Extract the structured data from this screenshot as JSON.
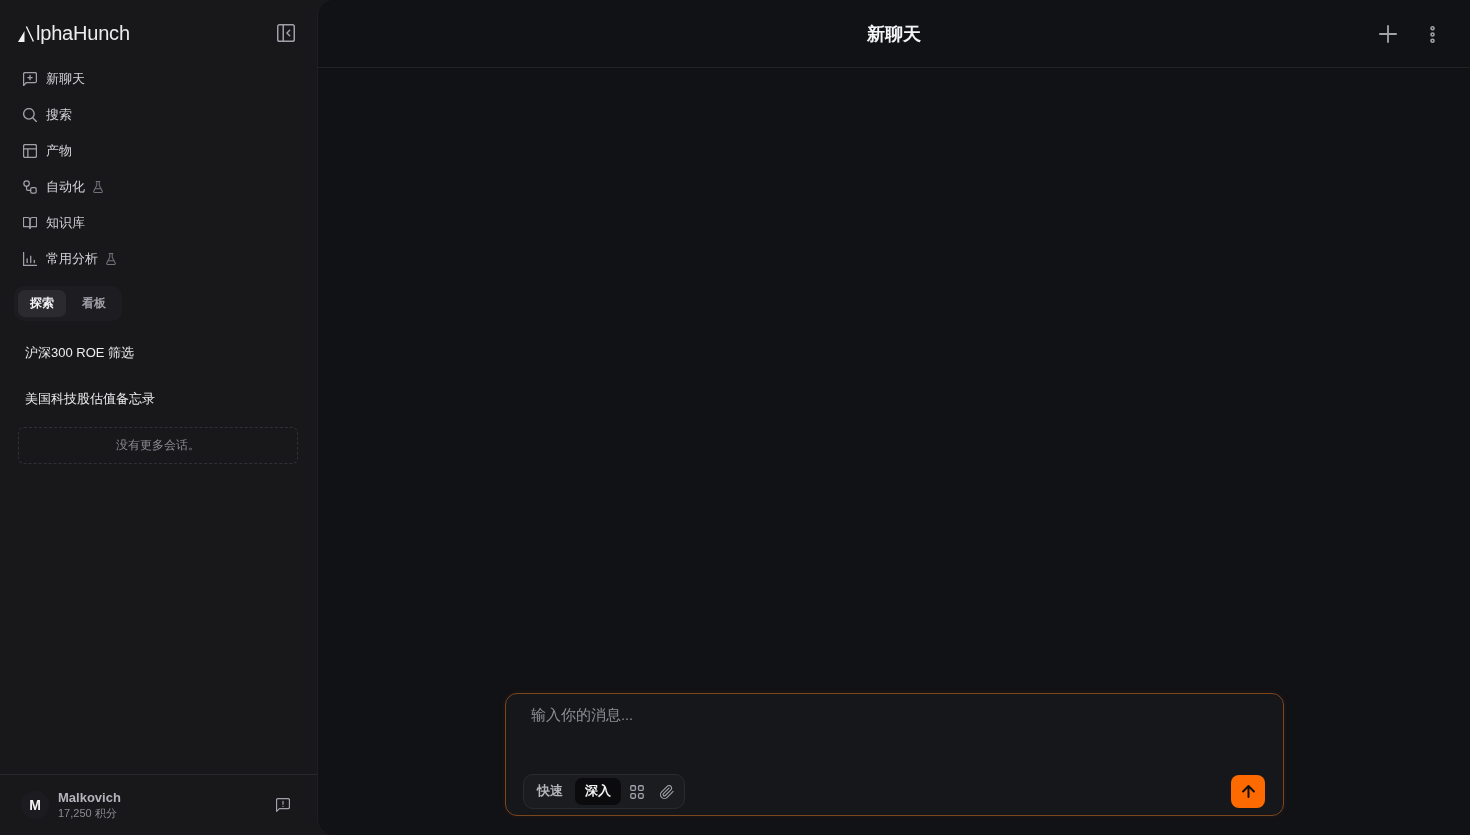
{
  "sidebar": {
    "logo_text": "lphaHunch",
    "nav": [
      {
        "label": "新聊天",
        "experimental": false
      },
      {
        "label": "搜索",
        "experimental": false
      },
      {
        "label": "产物",
        "experimental": false
      },
      {
        "label": "自动化",
        "experimental": true
      },
      {
        "label": "知识库",
        "experimental": false
      },
      {
        "label": "常用分析",
        "experimental": true
      }
    ],
    "tabs": [
      {
        "label": "探索",
        "selected": true
      },
      {
        "label": "看板",
        "selected": false
      }
    ],
    "conversations": [
      "沪深300 ROE 筛选",
      "美国科技股估值备忘录"
    ],
    "end_note": "没有更多会话。",
    "user": {
      "initial": "M",
      "name": "Malkovich",
      "points": "17,250 积分"
    }
  },
  "header": {
    "title": "新聊天"
  },
  "composer": {
    "placeholder": "输入你的消息...",
    "modes": [
      {
        "label": "快速",
        "selected": false
      },
      {
        "label": "深入",
        "selected": true
      }
    ]
  }
}
